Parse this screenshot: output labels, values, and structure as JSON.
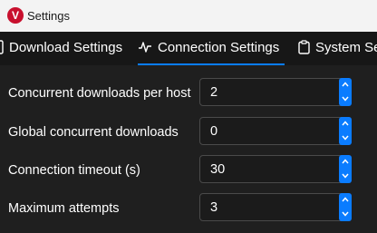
{
  "window": {
    "title": "Settings",
    "icon": "vivaldi-logo",
    "icon_letter": "V",
    "accent": "#0a7cff",
    "brand_color": "#c8102e"
  },
  "tabs": [
    {
      "label": "Download Settings",
      "icon": "download-icon",
      "active": false
    },
    {
      "label": "Connection Settings",
      "icon": "activity-icon",
      "active": true
    },
    {
      "label": "System Set",
      "icon": "clipboard-icon",
      "active": false
    }
  ],
  "settings": [
    {
      "label": "Concurrent downloads per host",
      "value": "2"
    },
    {
      "label": "Global concurrent downloads",
      "value": "0"
    },
    {
      "label": "Connection timeout (s)",
      "value": "30"
    },
    {
      "label": "Maximum attempts",
      "value": "3"
    }
  ]
}
